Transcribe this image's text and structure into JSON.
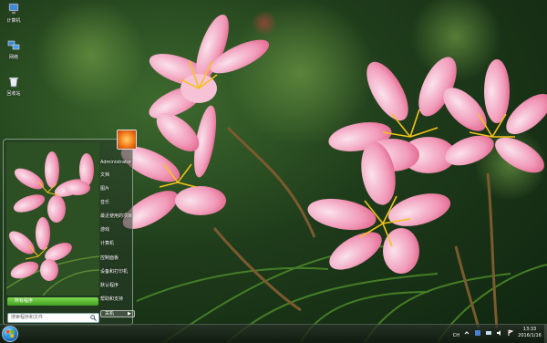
{
  "desktop": {
    "icons": [
      {
        "label": "计算机",
        "icon": "computer-icon"
      },
      {
        "label": "网络",
        "icon": "network-icon"
      },
      {
        "label": "回收站",
        "icon": "recycle-bin-icon"
      }
    ]
  },
  "start_menu": {
    "user_name": "Administrator",
    "items": [
      "文档",
      "图片",
      "音乐",
      "游戏",
      "计算机",
      "控制面板",
      "设备和打印机",
      "默认程序",
      "帮助和支持"
    ],
    "faded_items": [
      "最近使用的项目"
    ],
    "all_programs_label": "所有程序",
    "search_placeholder": "搜索程序和文件",
    "shutdown_label": "关机",
    "shutdown_arrow": "▶"
  },
  "taskbar": {
    "tray_lang": "CH",
    "clock_time": "13:33",
    "clock_date": "2016/1/16"
  },
  "colors": {
    "accent_green": "#3f9d21",
    "flower_pink": "#e9577f",
    "flower_light": "#f6b8cf",
    "pollen": "#f4c21b",
    "foliage_dark": "#1e3b1a"
  }
}
